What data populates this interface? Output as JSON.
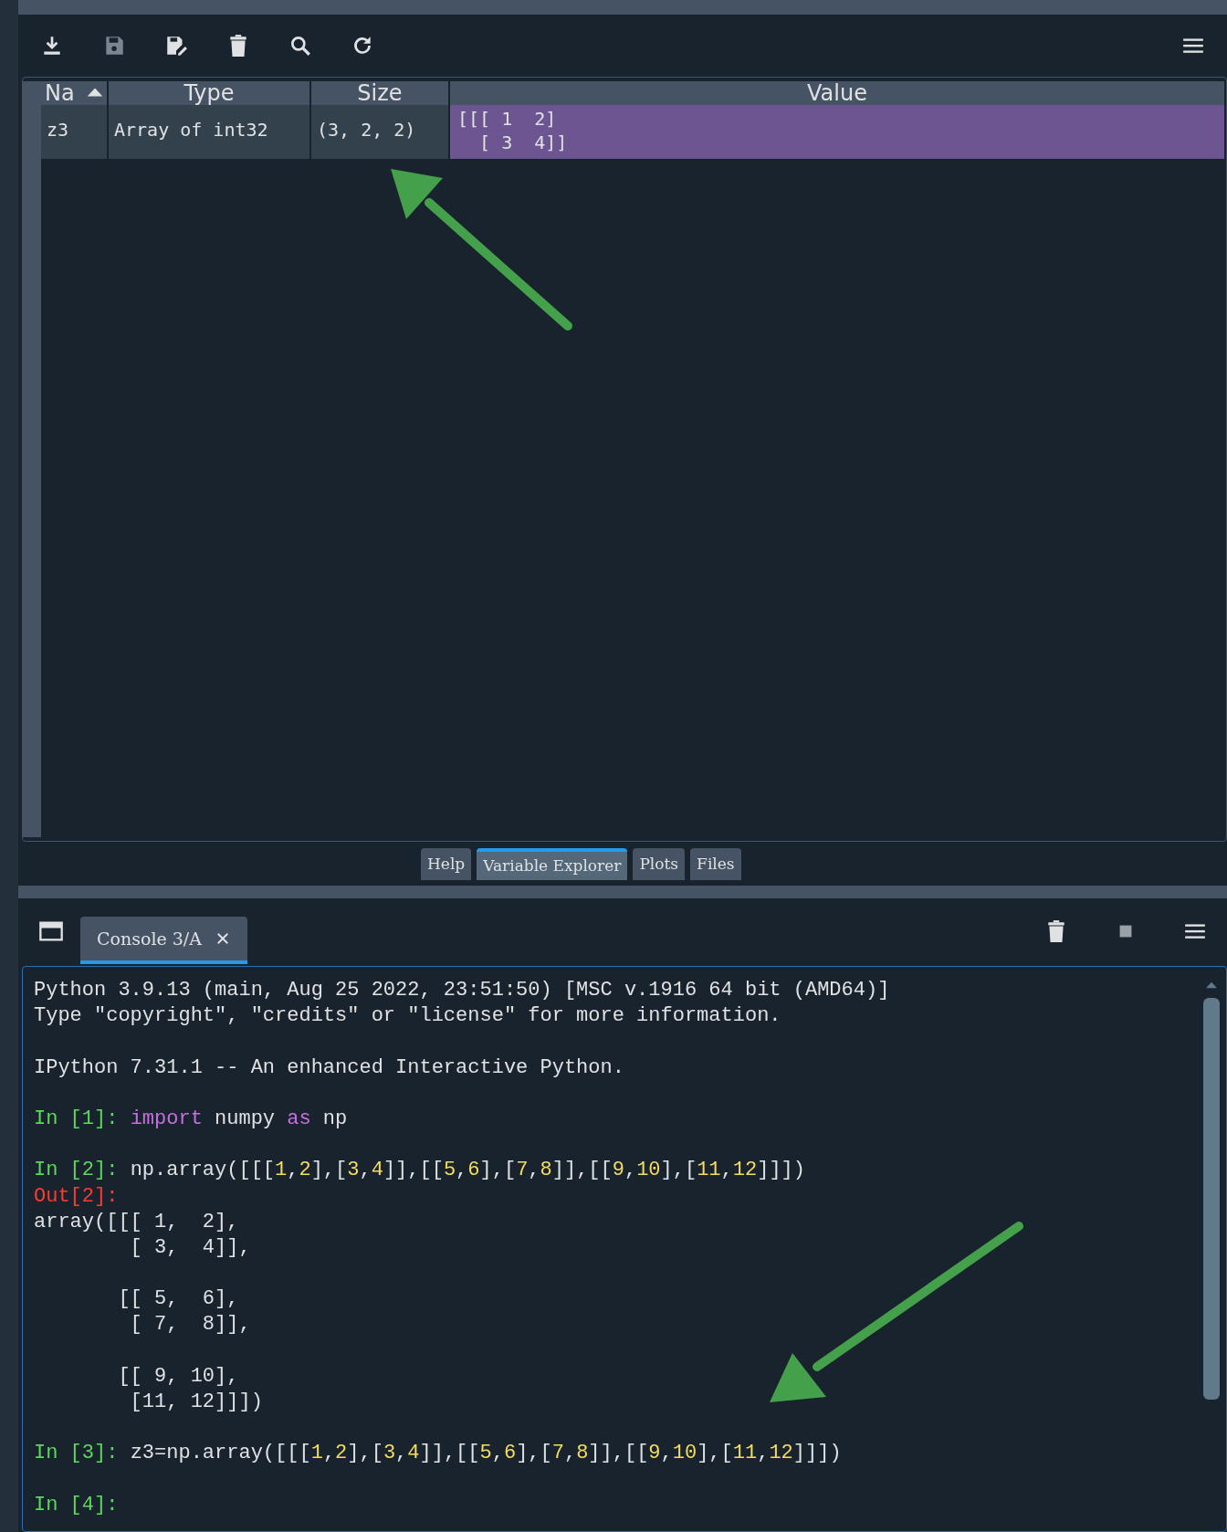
{
  "variable_explorer": {
    "toolbar": [
      {
        "kind": "import",
        "disabled": false
      },
      {
        "kind": "save",
        "disabled": true
      },
      {
        "kind": "save-as",
        "disabled": false
      },
      {
        "kind": "delete",
        "disabled": false
      },
      {
        "kind": "search",
        "disabled": false
      },
      {
        "kind": "refresh",
        "disabled": false
      }
    ],
    "table": {
      "columns": [
        {
          "label": "Na",
          "sorted": true
        },
        {
          "label": "Type",
          "sorted": false
        },
        {
          "label": "Size",
          "sorted": false
        },
        {
          "label": "Value",
          "sorted": false
        }
      ],
      "rows": [
        {
          "name": "z3",
          "type": "Array of int32",
          "size": "(3, 2, 2)",
          "value": [
            "[[[ 1  2]",
            "  [ 3  4]]"
          ],
          "selected": true
        }
      ]
    }
  },
  "pane_tabs": [
    {
      "label": "Help",
      "selected": false
    },
    {
      "label": "Variable Explorer",
      "selected": true
    },
    {
      "label": "Plots",
      "selected": false
    },
    {
      "label": "Files",
      "selected": false
    }
  ],
  "console": {
    "tabs": [
      {
        "label": "Console 3/A",
        "selected": true
      }
    ],
    "blocks": [
      [
        [
          {
            "kind": "plain",
            "text": "Python 3.9.13 (main, Aug 25 2022, 23:51:50) [MSC v.1916 64 bit (AMD64)]"
          }
        ],
        [
          {
            "kind": "plain",
            "text": "Type \"copyright\", \"credits\" or \"license\" for more information."
          }
        ]
      ],
      [
        [
          {
            "kind": "plain",
            "text": "IPython 7.31.1 -- An enhanced Interactive Python."
          }
        ]
      ],
      [
        [
          {
            "kind": "prompt",
            "text": "In [1]: "
          },
          {
            "kind": "keyword",
            "text": "import"
          },
          {
            "kind": "plain",
            "text": " numpy "
          },
          {
            "kind": "keyword",
            "text": "as"
          },
          {
            "kind": "plain",
            "text": " np"
          }
        ]
      ],
      [
        [
          {
            "kind": "prompt",
            "text": "In [2]: "
          },
          {
            "kind": "plain",
            "text": "np.array([[["
          },
          {
            "kind": "number",
            "text": "1"
          },
          {
            "kind": "plain",
            "text": ","
          },
          {
            "kind": "number",
            "text": "2"
          },
          {
            "kind": "plain",
            "text": "],["
          },
          {
            "kind": "number",
            "text": "3"
          },
          {
            "kind": "plain",
            "text": ","
          },
          {
            "kind": "number",
            "text": "4"
          },
          {
            "kind": "plain",
            "text": "]],[["
          },
          {
            "kind": "number",
            "text": "5"
          },
          {
            "kind": "plain",
            "text": ","
          },
          {
            "kind": "number",
            "text": "6"
          },
          {
            "kind": "plain",
            "text": "],["
          },
          {
            "kind": "number",
            "text": "7"
          },
          {
            "kind": "plain",
            "text": ","
          },
          {
            "kind": "number",
            "text": "8"
          },
          {
            "kind": "plain",
            "text": "]],[["
          },
          {
            "kind": "number",
            "text": "9"
          },
          {
            "kind": "plain",
            "text": ","
          },
          {
            "kind": "number",
            "text": "10"
          },
          {
            "kind": "plain",
            "text": "],["
          },
          {
            "kind": "number",
            "text": "11"
          },
          {
            "kind": "plain",
            "text": ","
          },
          {
            "kind": "number",
            "text": "12"
          },
          {
            "kind": "plain",
            "text": "]]])"
          }
        ],
        [
          {
            "kind": "out",
            "text": "Out[2]:"
          }
        ],
        [
          {
            "kind": "plain",
            "text": "array([[[ 1,  2],"
          }
        ],
        [
          {
            "kind": "plain",
            "text": "        [ 3,  4]],"
          }
        ]
      ],
      [
        [
          {
            "kind": "plain",
            "text": "       [[ 5,  6],"
          }
        ],
        [
          {
            "kind": "plain",
            "text": "        [ 7,  8]],"
          }
        ]
      ],
      [
        [
          {
            "kind": "plain",
            "text": "       [[ 9, 10],"
          }
        ],
        [
          {
            "kind": "plain",
            "text": "        [11, 12]]])"
          }
        ]
      ],
      [
        [
          {
            "kind": "prompt",
            "text": "In [3]: "
          },
          {
            "kind": "plain",
            "text": "z3=np.array([[["
          },
          {
            "kind": "number",
            "text": "1"
          },
          {
            "kind": "plain",
            "text": ","
          },
          {
            "kind": "number",
            "text": "2"
          },
          {
            "kind": "plain",
            "text": "],["
          },
          {
            "kind": "number",
            "text": "3"
          },
          {
            "kind": "plain",
            "text": ","
          },
          {
            "kind": "number",
            "text": "4"
          },
          {
            "kind": "plain",
            "text": "]],[["
          },
          {
            "kind": "number",
            "text": "5"
          },
          {
            "kind": "plain",
            "text": ","
          },
          {
            "kind": "number",
            "text": "6"
          },
          {
            "kind": "plain",
            "text": "],["
          },
          {
            "kind": "number",
            "text": "7"
          },
          {
            "kind": "plain",
            "text": ","
          },
          {
            "kind": "number",
            "text": "8"
          },
          {
            "kind": "plain",
            "text": "]],[["
          },
          {
            "kind": "number",
            "text": "9"
          },
          {
            "kind": "plain",
            "text": ","
          },
          {
            "kind": "number",
            "text": "10"
          },
          {
            "kind": "plain",
            "text": "],["
          },
          {
            "kind": "number",
            "text": "11"
          },
          {
            "kind": "plain",
            "text": ","
          },
          {
            "kind": "number",
            "text": "12"
          },
          {
            "kind": "plain",
            "text": "]]])"
          }
        ]
      ],
      [
        [
          {
            "kind": "prompt",
            "text": "In [4]:"
          }
        ]
      ]
    ]
  }
}
